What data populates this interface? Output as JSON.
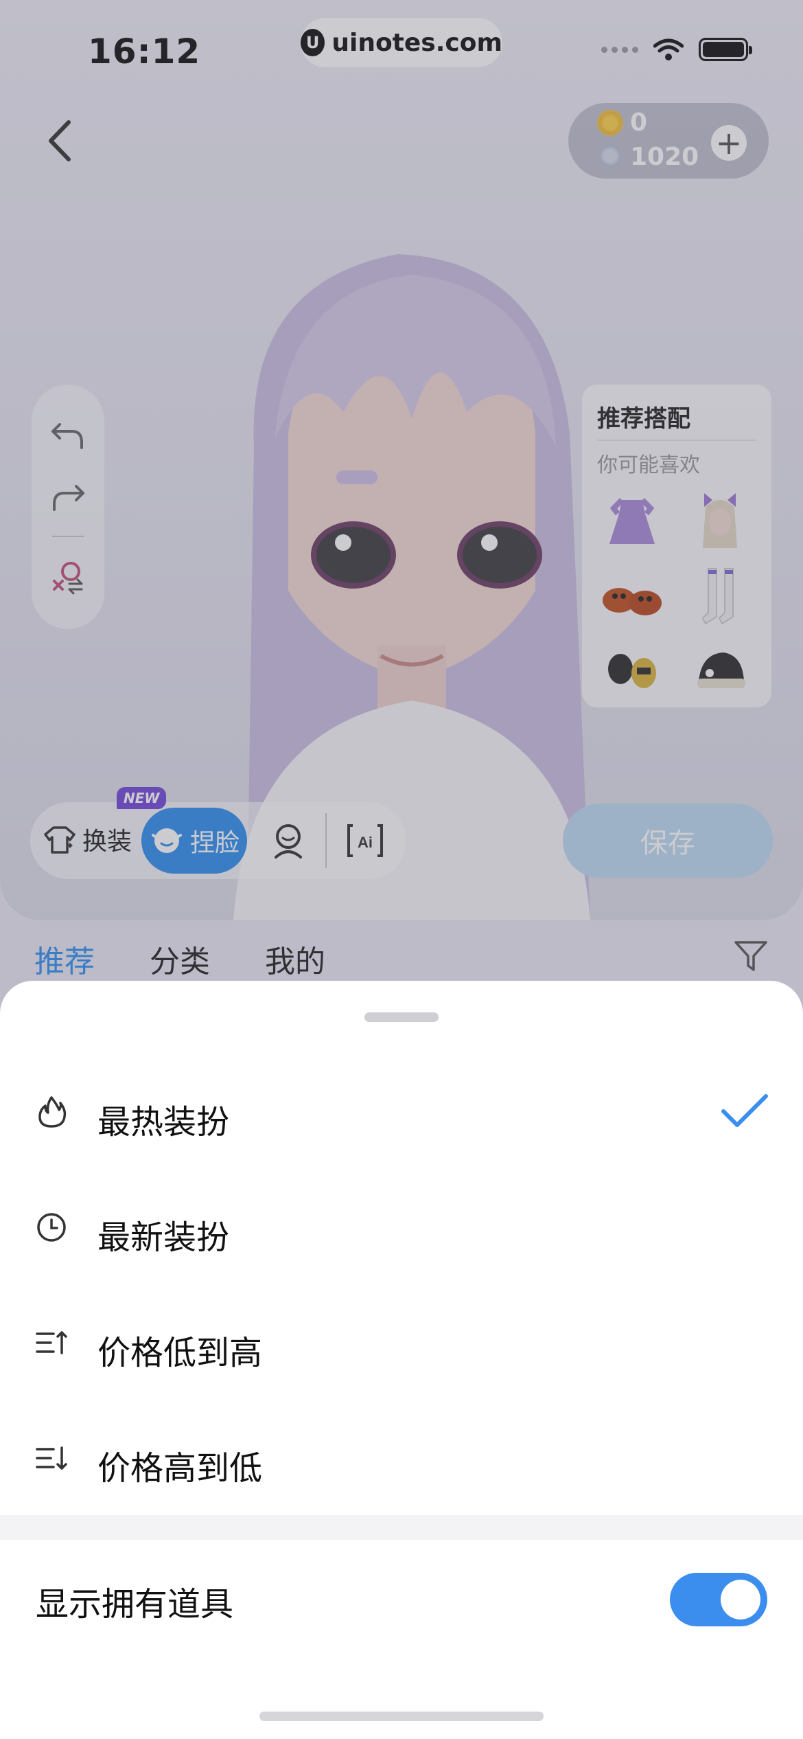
{
  "status_bar": {
    "time": "16:12",
    "watermark": "uinotes.com"
  },
  "currency": {
    "gold": "0",
    "silver": "1020"
  },
  "recommend": {
    "title": "推荐搭配",
    "subtitle": "你可能喜欢"
  },
  "toolbar": {
    "new_badge": "NEW",
    "change_outfit": "换装",
    "face_edit": "捏脸",
    "save": "保存"
  },
  "tabs": [
    "推荐",
    "分类",
    "我的"
  ],
  "sort_sheet": {
    "options": [
      {
        "label": "最热装扮",
        "icon": "flame-icon",
        "selected": true
      },
      {
        "label": "最新装扮",
        "icon": "clock-icon",
        "selected": false
      },
      {
        "label": "价格低到高",
        "icon": "sort-ascending-icon",
        "selected": false
      },
      {
        "label": "价格高到低",
        "icon": "sort-descending-icon",
        "selected": false
      }
    ],
    "toggle": {
      "label": "显示拥有道具",
      "on": true
    }
  },
  "colors": {
    "accent": "#3b8eee",
    "tab_active": "#2f8ff0"
  }
}
